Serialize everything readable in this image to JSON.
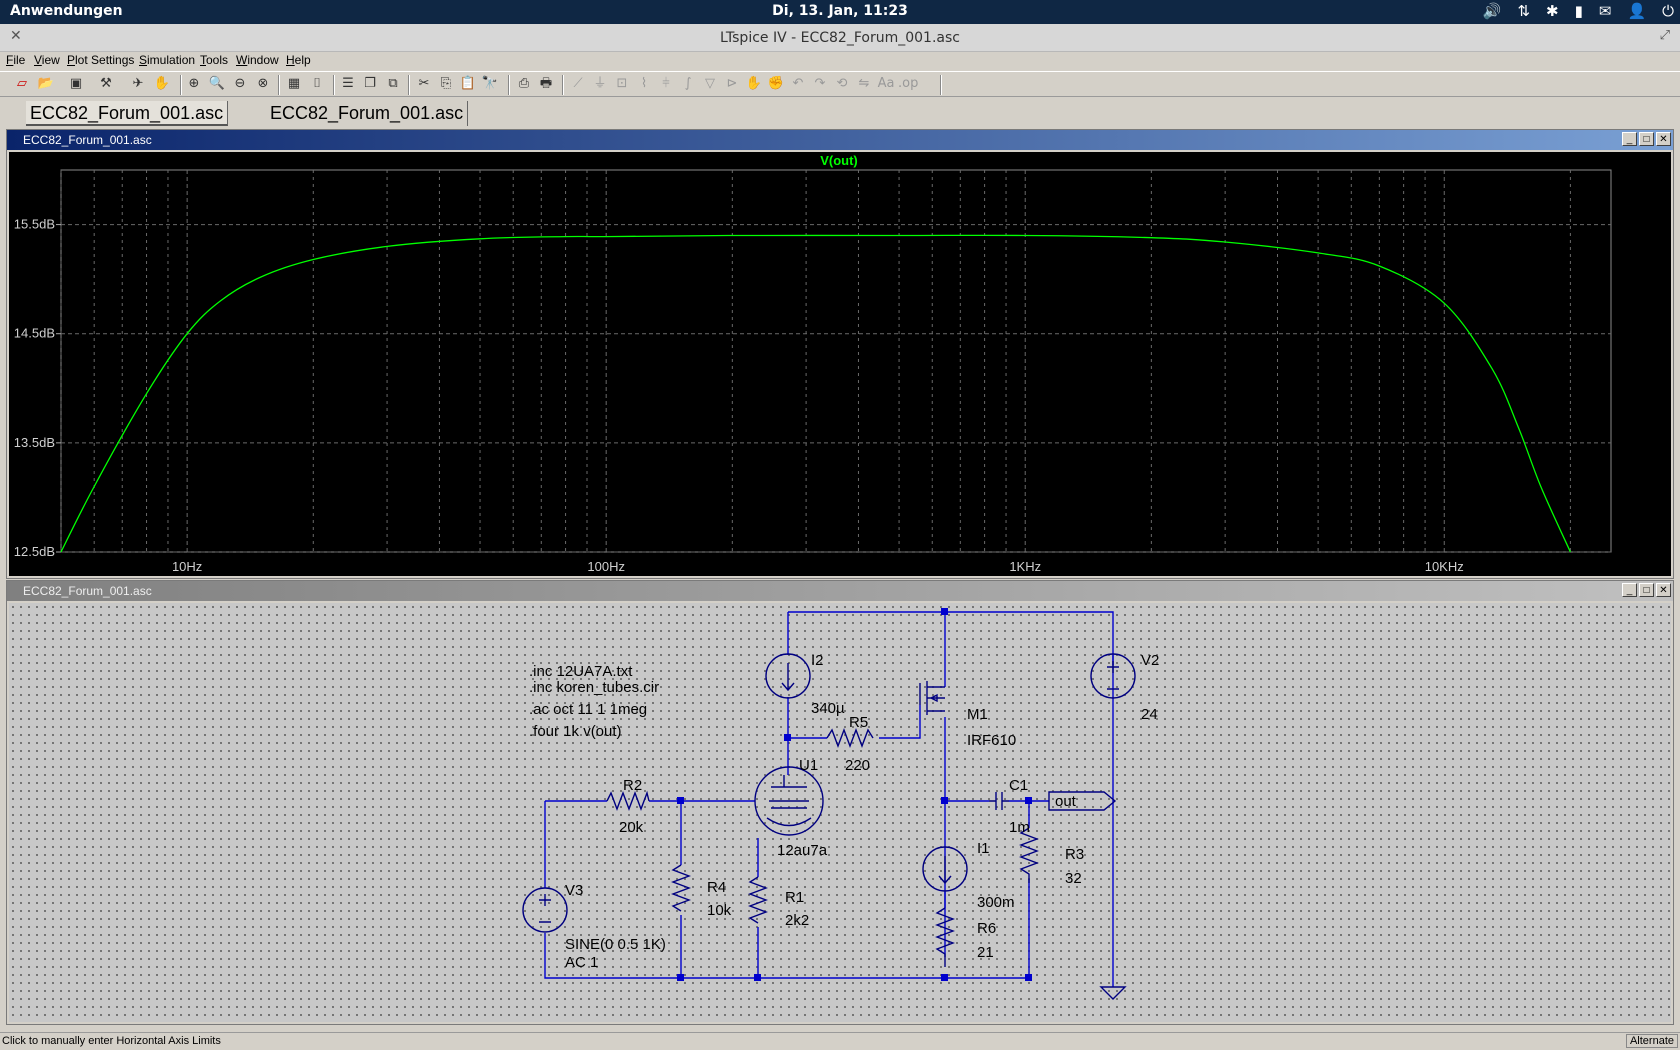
{
  "topbar": {
    "apps": "Anwendungen",
    "clock": "Di, 13. Jan, 11:23"
  },
  "window": {
    "title": "LTspice IV - ECC82_Forum_001.asc"
  },
  "menu": [
    "File",
    "View",
    "Plot Settings",
    "Simulation",
    "Tools",
    "Window",
    "Help"
  ],
  "tabs": [
    "ECC82_Forum_001.asc",
    "ECC82_Forum_001.asc"
  ],
  "plot_window": {
    "title": "ECC82_Forum_001.asc"
  },
  "schematic_window": {
    "title": "ECC82_Forum_001.asc"
  },
  "chart_data": {
    "type": "line",
    "title": "V(out)",
    "x_scale": "log",
    "xlim": [
      5,
      25000
    ],
    "ylim": [
      12.5,
      16.0
    ],
    "x_ticks": [
      10,
      100,
      1000,
      10000
    ],
    "x_tick_labels": [
      "10Hz",
      "100Hz",
      "1KHz",
      "10KHz"
    ],
    "y_ticks": [
      12.5,
      13.5,
      14.5,
      15.5
    ],
    "y_tick_labels": [
      "12.5dB",
      "13.5dB",
      "14.5dB",
      "15.5dB"
    ],
    "grid": true,
    "series": [
      {
        "name": "V(out)",
        "color": "#00ff00",
        "x": [
          5,
          6,
          8,
          10,
          12,
          15,
          20,
          30,
          50,
          80,
          100,
          200,
          500,
          1000,
          2000,
          3000,
          5000,
          7000,
          10000,
          13000,
          15000,
          17000,
          20000
        ],
        "y": [
          12.5,
          13.1,
          13.95,
          14.5,
          14.8,
          15.02,
          15.18,
          15.3,
          15.37,
          15.39,
          15.39,
          15.4,
          15.4,
          15.4,
          15.38,
          15.34,
          15.24,
          15.12,
          14.78,
          14.18,
          13.65,
          13.1,
          12.5
        ]
      }
    ]
  },
  "schematic": {
    "directives": [
      ".inc 12UA7A.txt",
      ".inc koren_tubes.cir",
      ".ac oct 11 1 1meg",
      ".four 1k v(out)"
    ],
    "components": [
      {
        "ref": "I2",
        "value": "340µ"
      },
      {
        "ref": "R5",
        "value": "220"
      },
      {
        "ref": "M1",
        "value": "IRF610"
      },
      {
        "ref": "V2",
        "value": "24"
      },
      {
        "ref": "U1",
        "value": "12au7a"
      },
      {
        "ref": "R2",
        "value": "20k"
      },
      {
        "ref": "C1",
        "value": "1m"
      },
      {
        "ref": "I1",
        "value": "300m"
      },
      {
        "ref": "R3",
        "value": "32"
      },
      {
        "ref": "R4",
        "value": "10k"
      },
      {
        "ref": "R1",
        "value": "2k2"
      },
      {
        "ref": "R6",
        "value": "21"
      },
      {
        "ref": "V3",
        "value": "SINE(0 0.5 1K)",
        "extra": "AC 1"
      }
    ],
    "net_label": "out"
  },
  "status": {
    "message": "Click to manually enter Horizontal Axis Limits",
    "right": "Alternate"
  }
}
